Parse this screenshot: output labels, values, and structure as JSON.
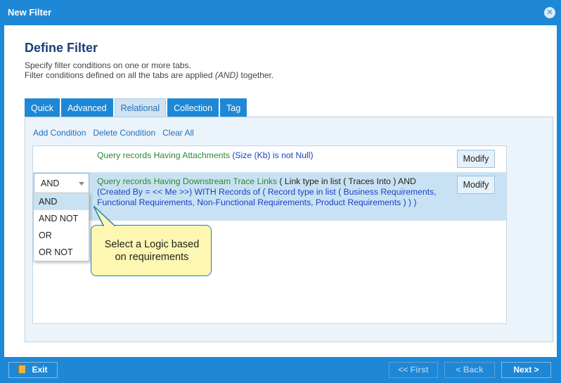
{
  "window": {
    "title": "New Filter",
    "close_icon": "close-icon"
  },
  "header": {
    "title": "Define Filter",
    "desc_line1": "Specify filter conditions on one or more tabs.",
    "desc_line2_pre": "Filter conditions defined on all the tabs are applied ",
    "desc_line2_italic": "(AND)",
    "desc_line2_post": " together."
  },
  "tabs": [
    {
      "label": "Quick"
    },
    {
      "label": "Advanced"
    },
    {
      "label": "Relational",
      "active": true
    },
    {
      "label": "Collection"
    },
    {
      "label": "Tag"
    }
  ],
  "actions": {
    "add": "Add Condition",
    "delete": "Delete Condition",
    "clear": "Clear All"
  },
  "conditions": [
    {
      "part1": "Query records Having Attachments ",
      "part2": "(Size (Kb) is not Null)",
      "modify": "Modify"
    },
    {
      "logic": "AND",
      "part1": "Query records Having Downstream Trace Links",
      "part2": " ( Link type in list ( Traces Into ) AND ",
      "part3": "(Created By = << Me >>) WITH Records of ( Record type in list ( Business Requirements, Functional Requirements, Non-Functional Requirements, Product Requirements ) ) )",
      "modify": "Modify"
    }
  ],
  "dropdown": {
    "options": [
      "AND",
      "AND NOT",
      "OR",
      "OR NOT"
    ],
    "selected": "AND"
  },
  "callout": {
    "line1": "Select a Logic based",
    "line2": "on requirements"
  },
  "footer": {
    "exit": "Exit",
    "first": "<< First",
    "back": "< Back",
    "next": "Next >"
  },
  "colors": {
    "chrome": "#1e88d6",
    "heading": "#1a3f7a",
    "green_text": "#2d8a2d",
    "blue_text": "#1a3fc7",
    "callout_bg": "#fdf7b2",
    "selected_row": "#c8e2f3"
  }
}
